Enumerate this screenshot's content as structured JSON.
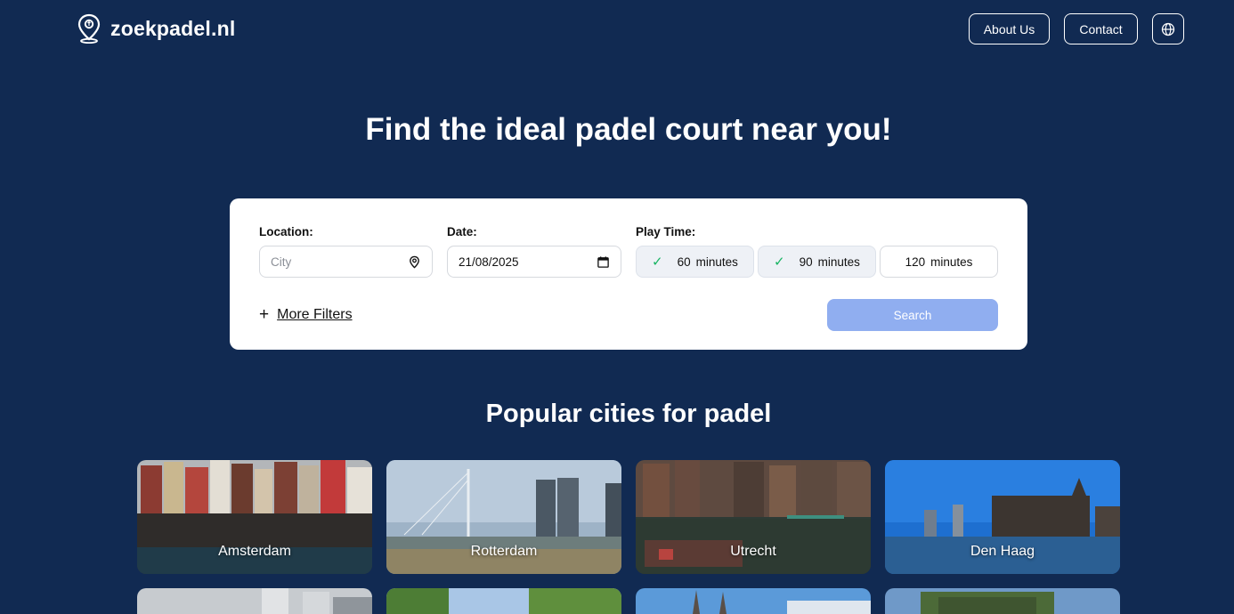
{
  "header": {
    "brand": "zoekpadel.nl",
    "nav": {
      "about": "About Us",
      "contact": "Contact"
    },
    "icons": {
      "logo": "map-pin-icon",
      "language": "globe-icon"
    }
  },
  "hero": {
    "title": "Find the ideal padel court near you!"
  },
  "search": {
    "location_label": "Location:",
    "location_placeholder": "City",
    "date_label": "Date:",
    "date_value": "21/08/2025",
    "play_time_label": "Play Time:",
    "play_times": [
      {
        "value": "60",
        "unit": "minutes",
        "selected": true
      },
      {
        "value": "90",
        "unit": "minutes",
        "selected": true
      },
      {
        "value": "120",
        "unit": "minutes",
        "selected": false
      }
    ],
    "more_filters": "More Filters",
    "search_button": "Search"
  },
  "popular": {
    "title": "Popular cities for padel",
    "cities": [
      {
        "name": "Amsterdam"
      },
      {
        "name": "Rotterdam"
      },
      {
        "name": "Utrecht"
      },
      {
        "name": "Den Haag"
      }
    ]
  },
  "colors": {
    "background": "#112a52",
    "search_button": "#90aef0",
    "check": "#18b463"
  }
}
